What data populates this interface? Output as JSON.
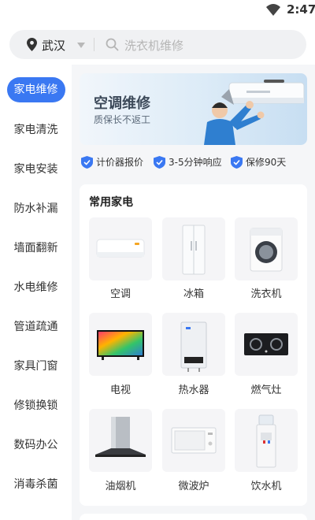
{
  "status_bar": {
    "time": "2:47",
    "wifi_icon": "wifi-icon"
  },
  "search": {
    "city": "武汉",
    "placeholder": "洗衣机维修"
  },
  "sidebar": {
    "items": [
      {
        "label": "家电维修",
        "active": true
      },
      {
        "label": "家电清洗",
        "active": false
      },
      {
        "label": "家电安装",
        "active": false
      },
      {
        "label": "防水补漏",
        "active": false
      },
      {
        "label": "墙面翻新",
        "active": false
      },
      {
        "label": "水电维修",
        "active": false
      },
      {
        "label": "管道疏通",
        "active": false
      },
      {
        "label": "家具门窗",
        "active": false
      },
      {
        "label": "修锁换锁",
        "active": false
      },
      {
        "label": "数码办公",
        "active": false
      },
      {
        "label": "消毒杀菌",
        "active": false
      }
    ]
  },
  "banner": {
    "title": "空调维修",
    "subtitle": "质保长不返工"
  },
  "promises": [
    {
      "label": "计价器报价",
      "icon": "shield-check-icon"
    },
    {
      "label": "3-5分钟响应",
      "icon": "shield-check-icon"
    },
    {
      "label": "保修90天",
      "icon": "shield-check-icon"
    }
  ],
  "appliances": {
    "title": "常用家电",
    "items": [
      {
        "label": "空调",
        "icon": "air-conditioner-icon"
      },
      {
        "label": "冰箱",
        "icon": "refrigerator-icon"
      },
      {
        "label": "洗衣机",
        "icon": "washing-machine-icon"
      },
      {
        "label": "电视",
        "icon": "television-icon"
      },
      {
        "label": "热水器",
        "icon": "water-heater-icon"
      },
      {
        "label": "燃气灶",
        "icon": "gas-stove-icon"
      },
      {
        "label": "油烟机",
        "icon": "range-hood-icon"
      },
      {
        "label": "微波炉",
        "icon": "microwave-icon"
      },
      {
        "label": "饮水机",
        "icon": "water-dispenser-icon"
      }
    ]
  },
  "colors": {
    "accent": "#3a78f2",
    "background": "#f5f6f8"
  }
}
